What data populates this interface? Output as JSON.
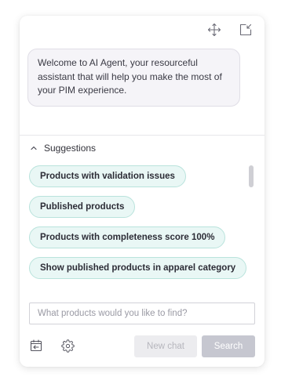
{
  "header": {
    "move_icon": "move-arrows-icon",
    "dock_icon": "dock-corner-icon"
  },
  "welcome_message": "Welcome to AI Agent, your resourceful assistant that will help you make the most of your PIM experience.",
  "suggestions": {
    "title": "Suggestions",
    "collapse_icon": "chevron-up-icon",
    "items": [
      "Products with validation issues",
      "Published products",
      "Products with completeness score 100%",
      "Show published products in apparel category"
    ]
  },
  "input": {
    "placeholder": "What products would you like to find?",
    "value": ""
  },
  "footer": {
    "history_icon": "calendar-back-icon",
    "settings_icon": "gear-icon",
    "new_chat_label": "New chat",
    "search_label": "Search"
  },
  "colors": {
    "chip_bg": "#e9f7f5",
    "chip_border": "#b9e3dc",
    "bubble_bg": "#f5f4f8",
    "search_btn": "#c6c7d0",
    "new_chat_btn": "#ececef"
  }
}
